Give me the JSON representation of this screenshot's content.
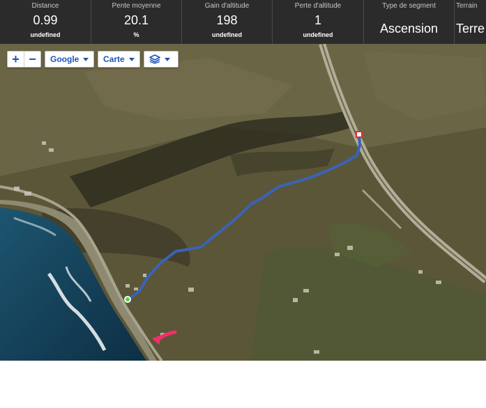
{
  "stats": [
    {
      "label": "Distance",
      "value": "0.99",
      "unit": "undefined"
    },
    {
      "label": "Pente moyenne",
      "value": "20.1",
      "unit": "%"
    },
    {
      "label": "Gain d'altitude",
      "value": "198",
      "unit": "undefined"
    },
    {
      "label": "Perte d'altitude",
      "value": "1",
      "unit": "undefined"
    },
    {
      "label": "Type de segment",
      "value": "Ascension"
    },
    {
      "label": "Terrain",
      "value": "Terre"
    }
  ],
  "map_controls": {
    "zoom_in": "+",
    "zoom_out": "−",
    "provider": "Google",
    "map_type": "Carte",
    "layers_icon": "layers-icon"
  },
  "colors": {
    "route": "#3a63b8",
    "start_marker": "#4fd43a",
    "end_marker": "#e8262b",
    "annotation_arrow": "#f0306a",
    "stats_background": "#2b2b2b"
  }
}
